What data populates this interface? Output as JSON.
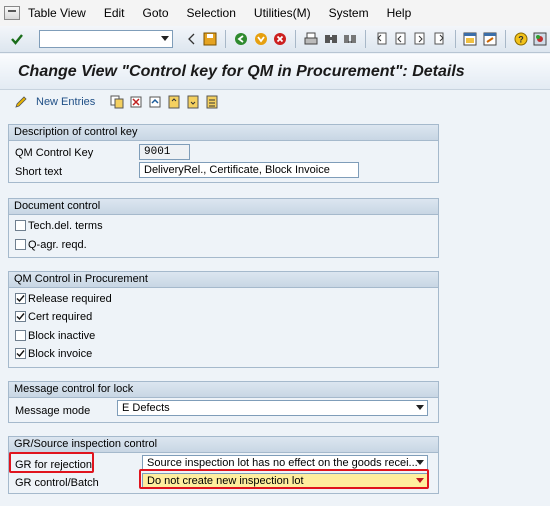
{
  "menubar": {
    "items": [
      {
        "label": "Table View",
        "u": "T"
      },
      {
        "label": "Edit",
        "u": "E"
      },
      {
        "label": "Goto",
        "u": "G"
      },
      {
        "label": "Selection",
        "u": "S"
      },
      {
        "label": "Utilities(M)",
        "u": "U"
      },
      {
        "label": "System",
        "u": "y"
      },
      {
        "label": "Help",
        "u": "H"
      }
    ]
  },
  "toolbar": {
    "command_value": ""
  },
  "title": "Change View \"Control key for QM in Procurement\": Details",
  "apptoolbar": {
    "new_entries": "New Entries"
  },
  "groups": {
    "description": {
      "header": "Description of control key",
      "qm_key_label": "QM Control Key",
      "qm_key_value": "9001",
      "short_text_label": "Short text",
      "short_text_value": "DeliveryRel., Certificate, Block Invoice"
    },
    "document": {
      "header": "Document control",
      "items": [
        {
          "label": "Tech.del. terms",
          "checked": false
        },
        {
          "label": "Q-agr. reqd.",
          "checked": false
        }
      ]
    },
    "qm_control": {
      "header": "QM Control in Procurement",
      "items": [
        {
          "label": "Release required",
          "checked": true
        },
        {
          "label": "Cert required",
          "checked": true
        },
        {
          "label": "Block inactive",
          "checked": false
        },
        {
          "label": "Block invoice",
          "checked": true
        }
      ]
    },
    "message": {
      "header": "Message control for lock",
      "mode_label": "Message mode",
      "mode_value": "E Defects"
    },
    "gr_source": {
      "header": "GR/Source inspection control",
      "gr_rejection_label": "GR for rejection",
      "gr_rejection_value": "Source inspection lot has no effect on the goods recei...",
      "gr_batch_label": "GR control/Batch",
      "gr_batch_value": "Do not create new inspection lot"
    }
  },
  "colors": {
    "highlight": "#e0141e",
    "focus_field": "#ffee9e"
  }
}
